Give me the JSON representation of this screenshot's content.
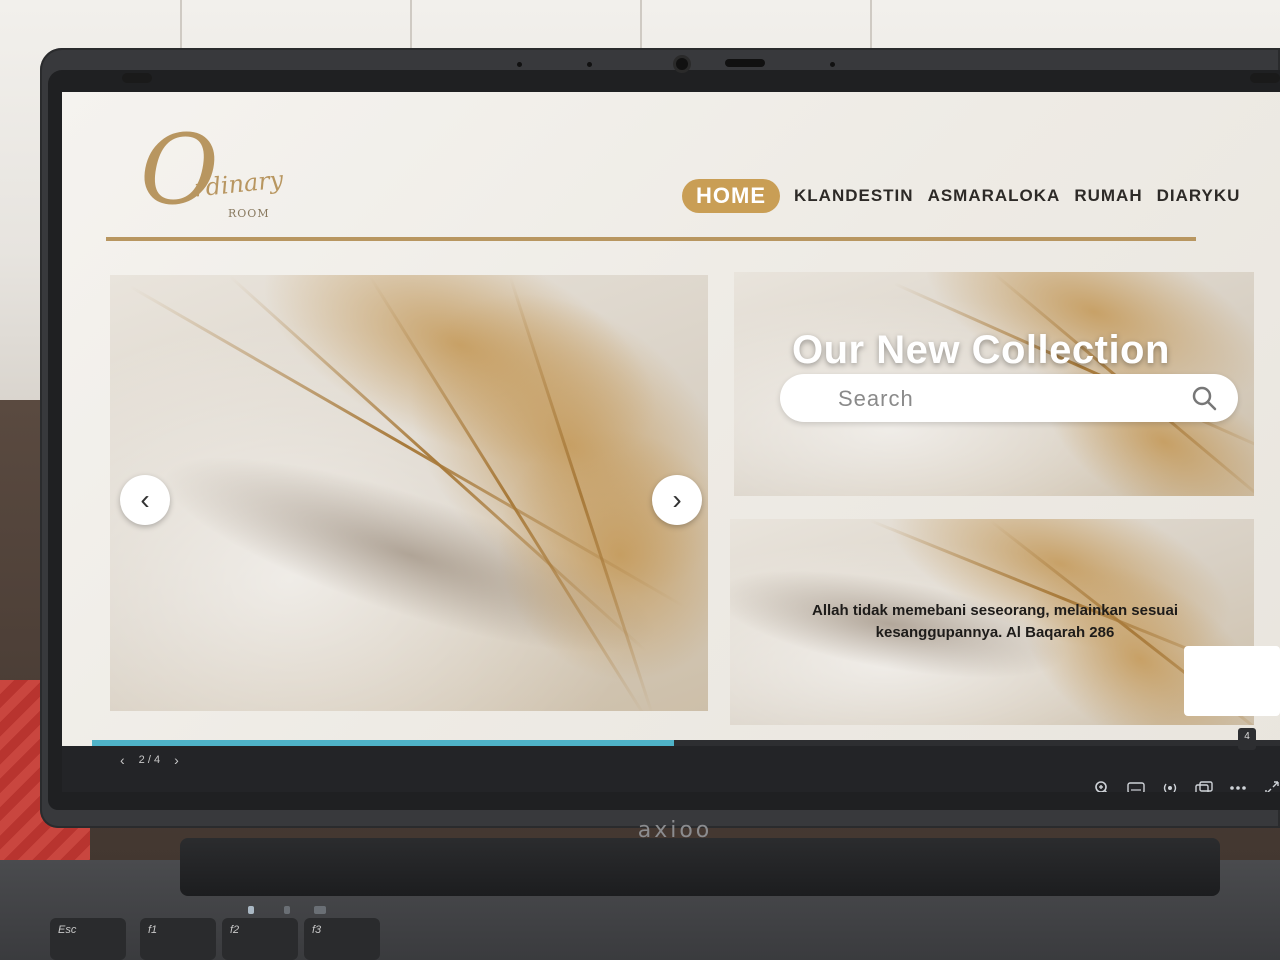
{
  "site": {
    "logo": {
      "script": "Ordinary",
      "room": "ROOM"
    },
    "nav": {
      "items": [
        {
          "label": "HOME"
        },
        {
          "label": "KLANDESTIN"
        },
        {
          "label": "ASMARALOKA"
        },
        {
          "label": "RUMAH"
        },
        {
          "label": "DIARYKU"
        }
      ]
    },
    "hero": {
      "prev_icon": "‹",
      "next_icon": "›"
    },
    "collection": {
      "title": "Our New Collection",
      "search_placeholder": "Search"
    },
    "quote": {
      "text": "Allah tidak memebani seseorang, melainkan sesuai kesanggupannya. Al Baqarah 286"
    }
  },
  "viewer": {
    "page_indicator": "2 / 4",
    "badge": "4",
    "progress_fraction": 0.49,
    "accent_color": "#4fb3c8",
    "tools": [
      "zoom-icon",
      "keyboard-icon",
      "cast-icon",
      "window-icon",
      "more-icon",
      "expand-icon"
    ]
  },
  "laptop": {
    "brand": "axioo",
    "keys": [
      "Esc",
      "f1",
      "f2",
      "f3"
    ]
  },
  "colors": {
    "gold": "#c99e55",
    "text": "#2d2a27"
  }
}
